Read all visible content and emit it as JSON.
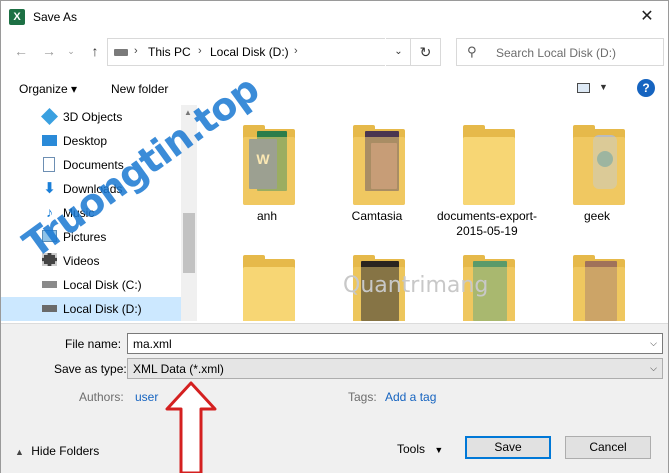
{
  "window": {
    "title": "Save As",
    "app_icon": "excel-icon"
  },
  "address": {
    "crumbs": [
      "This PC",
      "Local Disk (D:)"
    ],
    "search_placeholder": "Search Local Disk (D:)"
  },
  "toolbar": {
    "organize": "Organize ▾",
    "new_folder": "New folder",
    "help": "?"
  },
  "nav": {
    "items": [
      {
        "label": "3D Objects",
        "icon": "cube-icon"
      },
      {
        "label": "Desktop",
        "icon": "desktop-icon"
      },
      {
        "label": "Documents",
        "icon": "documents-icon"
      },
      {
        "label": "Downloads",
        "icon": "download-icon"
      },
      {
        "label": "Music",
        "icon": "music-icon"
      },
      {
        "label": "Pictures",
        "icon": "pictures-icon"
      },
      {
        "label": "Videos",
        "icon": "video-icon"
      },
      {
        "label": "Local Disk (C:)",
        "icon": "drive-icon"
      },
      {
        "label": "Local Disk (D:)",
        "icon": "drive-icon"
      }
    ]
  },
  "files": [
    {
      "name": "anh"
    },
    {
      "name": "Camtasia"
    },
    {
      "name": "documents-export-2015-05-19"
    },
    {
      "name": "geek"
    },
    {
      "name": ""
    },
    {
      "name": ""
    },
    {
      "name": ""
    },
    {
      "name": ""
    }
  ],
  "form": {
    "file_name_label": "File name:",
    "file_name_value": "ma.xml",
    "save_type_label": "Save as type:",
    "save_type_value": "XML Data (*.xml)",
    "authors_label": "Authors:",
    "authors_value": "user",
    "tags_label": "Tags:",
    "tags_value": "Add a tag",
    "hide_folders": "Hide Folders",
    "tools": "Tools",
    "save": "Save",
    "cancel": "Cancel"
  },
  "watermarks": {
    "left": "Truongtin.top",
    "center": "Quantrimang"
  }
}
